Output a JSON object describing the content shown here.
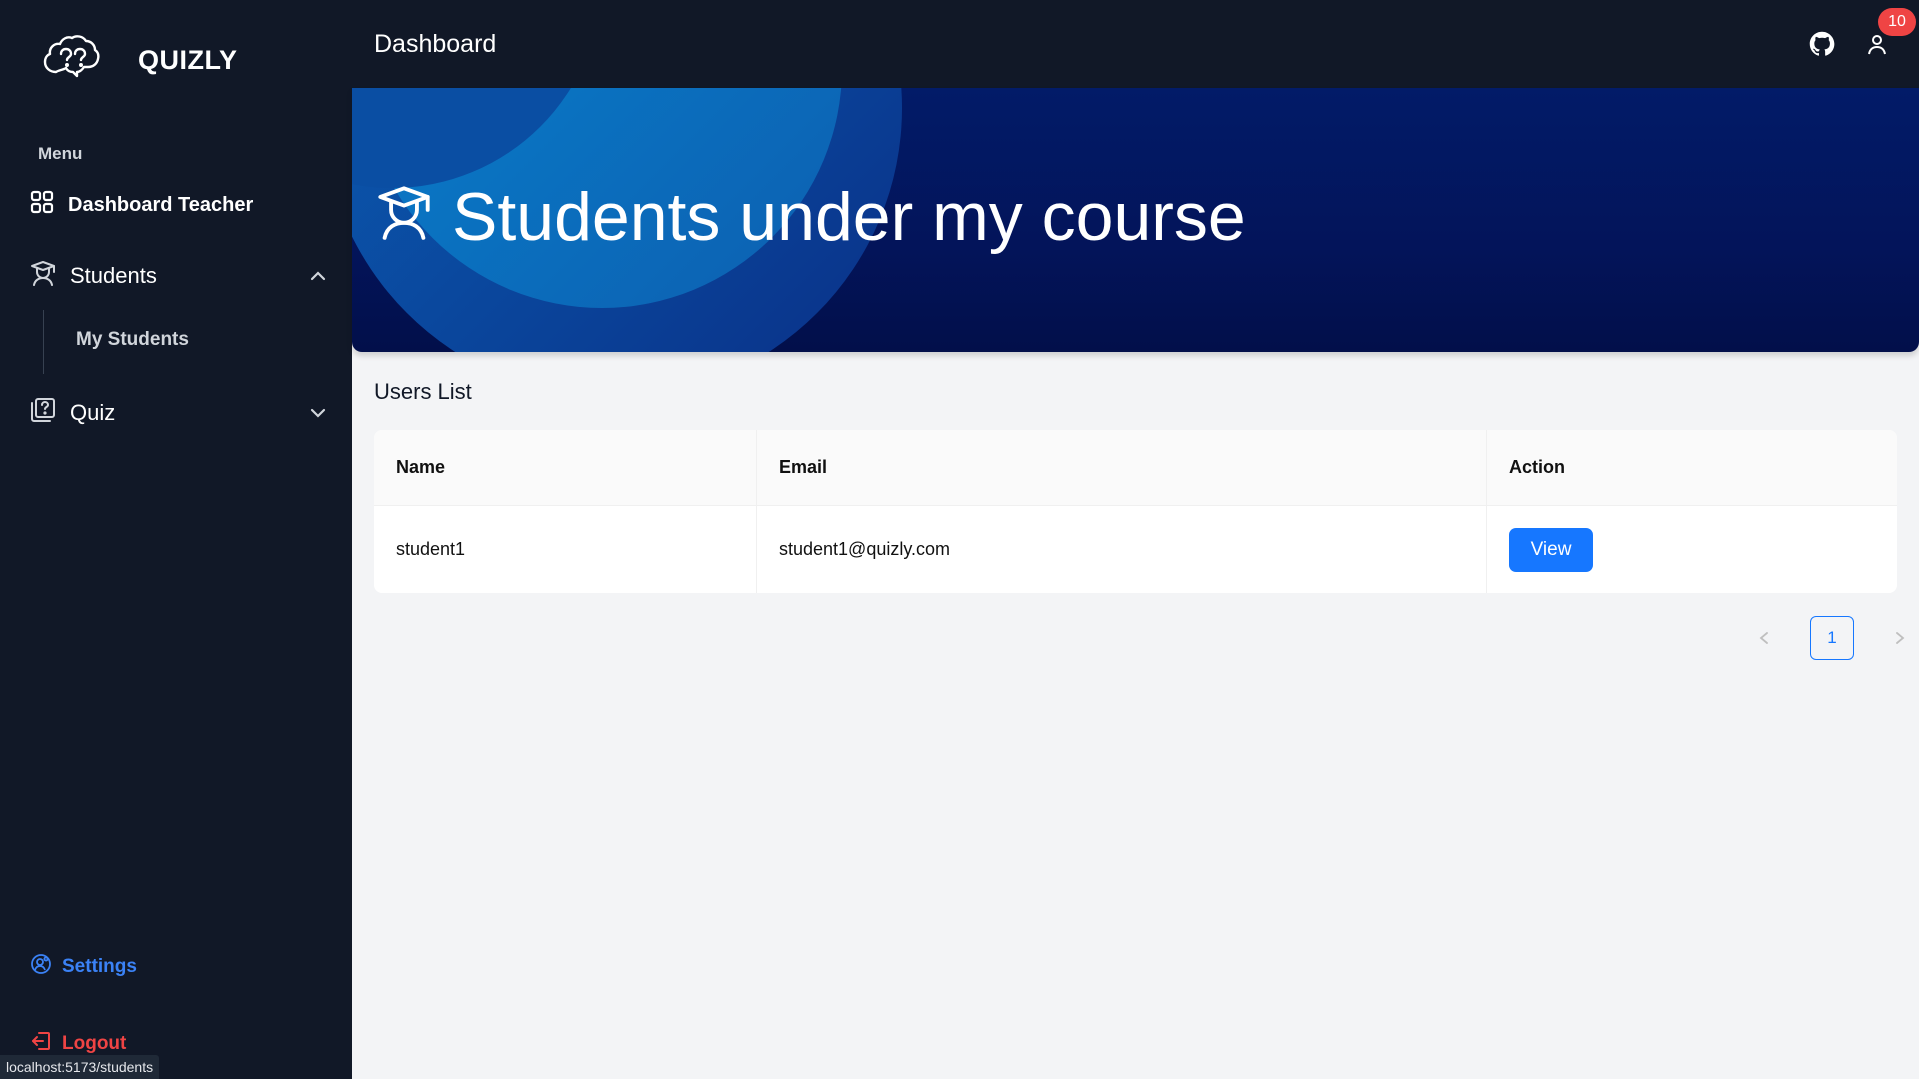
{
  "brand": {
    "name": "QUIZLY",
    "icon": "brain-question-icon"
  },
  "sidebar": {
    "menu_heading": "Menu",
    "items": [
      {
        "label": "Dashboard Teacher",
        "icon": "grid-icon"
      },
      {
        "label": "Students",
        "icon": "graduate-icon",
        "expanded": true,
        "children": [
          {
            "label": "My Students"
          }
        ]
      },
      {
        "label": "Quiz",
        "icon": "quiz-icon",
        "expanded": false
      }
    ],
    "settings_label": "Settings",
    "logout_label": "Logout"
  },
  "statusbar": {
    "url": "localhost:5173/students"
  },
  "topbar": {
    "title": "Dashboard",
    "notification_count": "10"
  },
  "banner": {
    "title": "Students under my course",
    "icon": "graduate-icon"
  },
  "users_list": {
    "title": "Users List",
    "columns": [
      "Name",
      "Email",
      "Action"
    ],
    "rows": [
      {
        "name": "student1",
        "email": "student1@quizly.com",
        "action": "View"
      }
    ]
  },
  "pagination": {
    "current_page": "1",
    "prev": "<",
    "next": ">"
  },
  "colors": {
    "sidebar_bg": "#111827",
    "primary": "#1677ff",
    "settings": "#3b82f6",
    "logout": "#ef4444",
    "badge": "#ef4444"
  }
}
